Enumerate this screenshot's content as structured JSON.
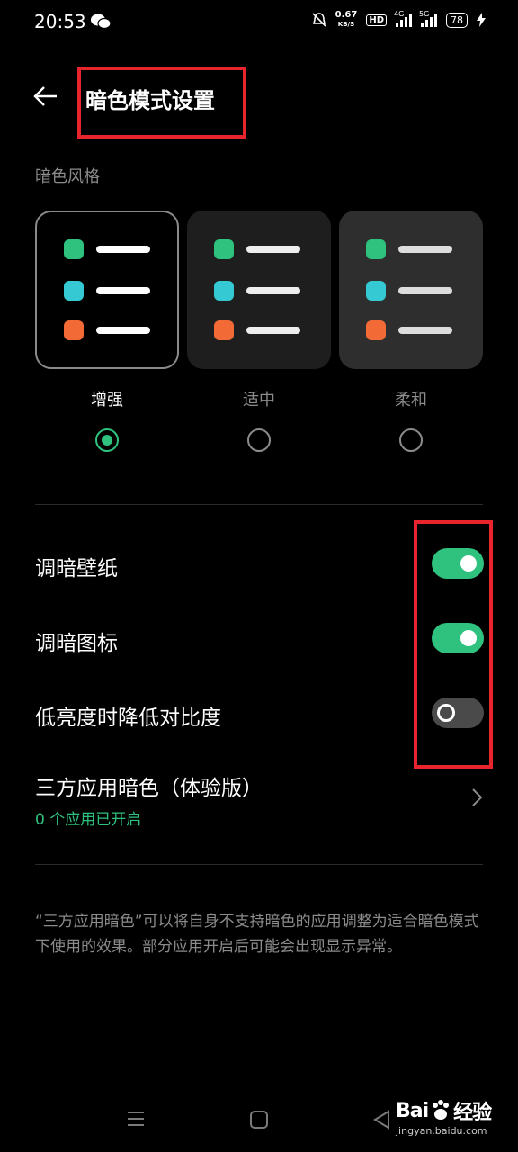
{
  "status_bar": {
    "time": "20:53",
    "net_speed_value": "0.67",
    "net_speed_unit": "KB/S",
    "hd_label": "HD",
    "sim1_tag": "4G",
    "sim2_tag": "5G",
    "battery": "78"
  },
  "header": {
    "title": "暗色模式设置"
  },
  "dark_style": {
    "section_label": "暗色风格",
    "options": [
      {
        "label": "增强",
        "selected": true
      },
      {
        "label": "适中",
        "selected": false
      },
      {
        "label": "柔和",
        "selected": false
      }
    ]
  },
  "settings": {
    "dim_wallpaper": {
      "label": "调暗壁纸",
      "enabled": true
    },
    "dim_icons": {
      "label": "调暗图标",
      "enabled": true
    },
    "low_contrast": {
      "label": "低亮度时降低对比度",
      "enabled": false
    },
    "third_party": {
      "label": "三方应用暗色（体验版）",
      "status": "0 个应用已开启"
    }
  },
  "footnote": "“三方应用暗色”可以将自身不支持暗色的应用调整为适合暗色模式下使用的效果。部分应用开启后可能会出现显示异常。",
  "watermark": {
    "brand": "Bai",
    "brand_suffix": "经验",
    "url": "jingyan.baidu.com"
  },
  "colors": {
    "accent": "#2ec27e",
    "highlight_box": "#e8242c",
    "background": "#000000"
  }
}
